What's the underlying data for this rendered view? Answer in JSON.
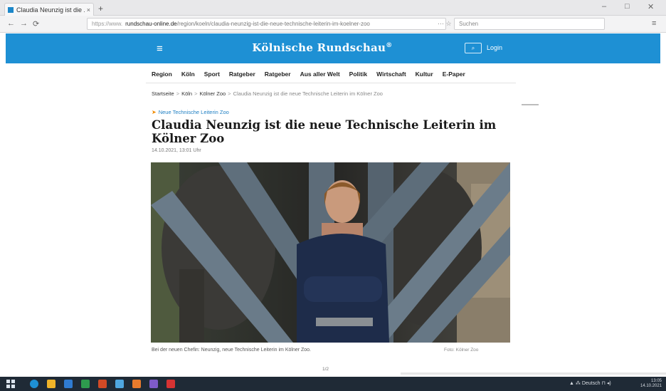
{
  "browser": {
    "tab_title": "Claudia Neunzig ist die ...",
    "tab_close": "×",
    "new_tab": "+",
    "back": "←",
    "forward": "→",
    "reload": "⟳",
    "url_prefix": "https://www.",
    "url_domain": "rundschau-online.de",
    "url_path": "/region/koeln/claudia-neunzig-ist-die-neue-technische-leiterin-im-koelner-zoo",
    "search_placeholder": "Suchen",
    "window_minimize": "–",
    "window_maximize": "□",
    "window_close": "✕",
    "menu": "≡"
  },
  "site": {
    "menu_icon": "≡",
    "logo": "Kölnische Rundschau",
    "logo_mark": "®",
    "search_label": "⌕",
    "login_label": "Login",
    "brand_color": "#1e90d4"
  },
  "nav": {
    "items": [
      "Region",
      "Köln",
      "Sport",
      "Ratgeber",
      "Ratgeber",
      "Aus aller Welt",
      "Politik",
      "Wirtschaft",
      "Kultur",
      "E-Paper"
    ]
  },
  "breadcrumb": {
    "items": [
      "Startseite",
      "Köln",
      "Kölner Zoo"
    ],
    "current": "Claudia Neunzig ist die neue Technische Leiterin im Kölner Zoo"
  },
  "article": {
    "kicker": "Neue Technische Leiterin Zoo",
    "headline": "Claudia Neunzig ist die neue Technische Leiterin im Kölner Zoo",
    "dateline": "14.10.2021, 13:01 Uhr",
    "caption": "Bei der neuen Chefin: Neunzig, neue Technische Leiterin im Kölner Zoo.",
    "credit": "Foto: Kölner Zoo"
  },
  "pager": "1/2",
  "taskbar": {
    "tray": "▲  ⁂  Deutsch  ⊓  ◂)",
    "time": "13:05",
    "date": "14.10.2021"
  }
}
